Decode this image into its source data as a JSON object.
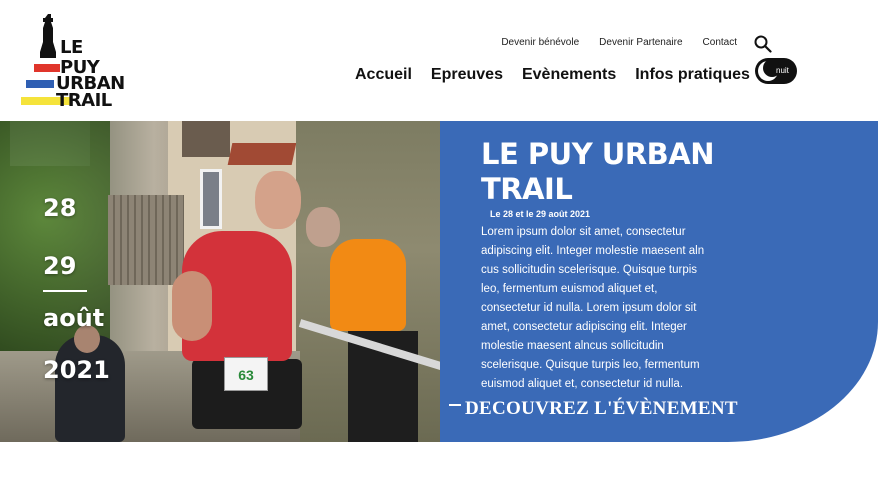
{
  "logo": {
    "line1": "LE",
    "line2": "PUY",
    "line3": "URBAN",
    "line4": "TRAIL"
  },
  "topnav": {
    "items": [
      "Devenir bénévole",
      "Devenir Partenaire",
      "Contact"
    ]
  },
  "mainnav": {
    "items": [
      "Accueil",
      "Epreuves",
      "Evènements",
      "Infos pratiques"
    ]
  },
  "theme_toggle": {
    "label": "nuit"
  },
  "hero": {
    "date_lines": [
      "28",
      "29",
      "août",
      "2021"
    ],
    "bib_number": "63"
  },
  "panel": {
    "title": "LE PUY URBAN TRAIL",
    "date": "Le 28 et le 29 août 2021",
    "body": "Lorem ipsum dolor sit amet, consectetur adipiscing elit. Integer molestie maesent aln cus sollicitudin scelerisque. Quisque turpis leo, fermentum euismod aliquet et, consectetur id nulla. Lorem ipsum dolor sit amet, consectetur adipiscing elit. Integer molestie maesent alncus sollicitudin scelerisque. Quisque turpis leo, fermentum euismod aliquet et, consectetur id nulla.",
    "cta": "DECOUVREZ L'ÉVÈNEMENT"
  },
  "colors": {
    "panel_blue": "#3a6ab7",
    "logo_red": "#e0352b",
    "logo_blue": "#2f5fb3",
    "logo_yellow": "#f5e33b"
  }
}
